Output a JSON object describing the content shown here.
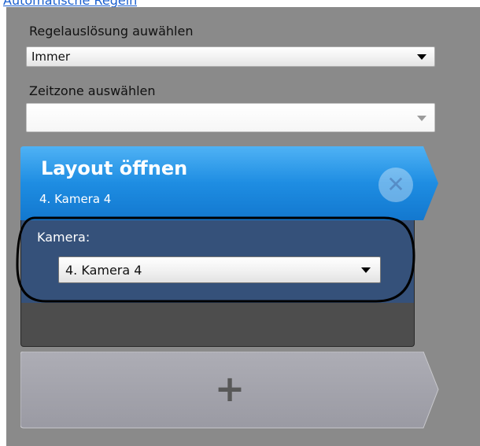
{
  "top_link": {
    "label": "Automatische Regeln"
  },
  "trigger": {
    "label": "Regelauslösung auwählen",
    "value": "Immer"
  },
  "timezone": {
    "label": "Zeitzone auswählen",
    "value": ""
  },
  "action_card": {
    "title": "Layout öffnen",
    "subtitle": "4. Kamera 4",
    "close_icon": "close-icon",
    "camera_label": "Kamera:",
    "camera_value": "4. Kamera 4"
  },
  "add_button": {
    "icon": "plus-icon"
  },
  "colors": {
    "panel_bg": "#8a8a8a",
    "header_blue": "#1e8de2",
    "card_body_blue": "#35517a",
    "card_footer": "#4d4d4d",
    "annotation_ellipse": "#000000",
    "link": "#1a5fd0"
  }
}
